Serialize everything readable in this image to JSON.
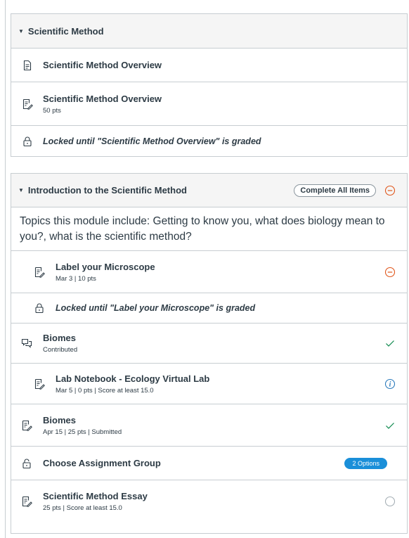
{
  "module1": {
    "title": "Scientific Method",
    "items": [
      {
        "title": "Scientific Method Overview",
        "type": "page"
      },
      {
        "title": "Scientific Method Overview",
        "meta": "50 pts",
        "type": "assignment"
      },
      {
        "locked_text": "Locked until \"Scientific Method Overview\" is graded",
        "type": "locked"
      }
    ]
  },
  "module2": {
    "title": "Introduction to the Scientific Method",
    "complete_all_label": "Complete All Items",
    "description": "Topics this module include: Getting to know you, what does biology mean to you?, what is the scientific method?",
    "items": [
      {
        "title": "Label your Microscope",
        "meta": "Mar 3 | 10 pts",
        "status": "minus-circle"
      },
      {
        "locked_text": "Locked until \"Label your Microscope\" is graded"
      },
      {
        "title": "Biomes",
        "meta": "Contributed",
        "status": "check"
      },
      {
        "title": "Lab Notebook - Ecology Virtual Lab",
        "meta": "Mar 5 | 0 pts | Score at least 15.0",
        "status": "info"
      },
      {
        "title": "Biomes",
        "meta": "Apr 15 | 25 pts | Submitted",
        "status": "check"
      },
      {
        "title": "Choose Assignment Group",
        "badge": "2 Options"
      },
      {
        "title": "Scientific Method Essay",
        "meta": "25 pts | Score at least 15.0",
        "status": "empty-circle"
      }
    ]
  },
  "colors": {
    "border": "#c7cdd1",
    "header_bg": "#f5f5f5",
    "text": "#2d3b45",
    "check_green": "#0b874b",
    "minus_orange": "#e0561b",
    "info_blue": "#2b7abc",
    "badge_blue": "#1a8fd9"
  }
}
